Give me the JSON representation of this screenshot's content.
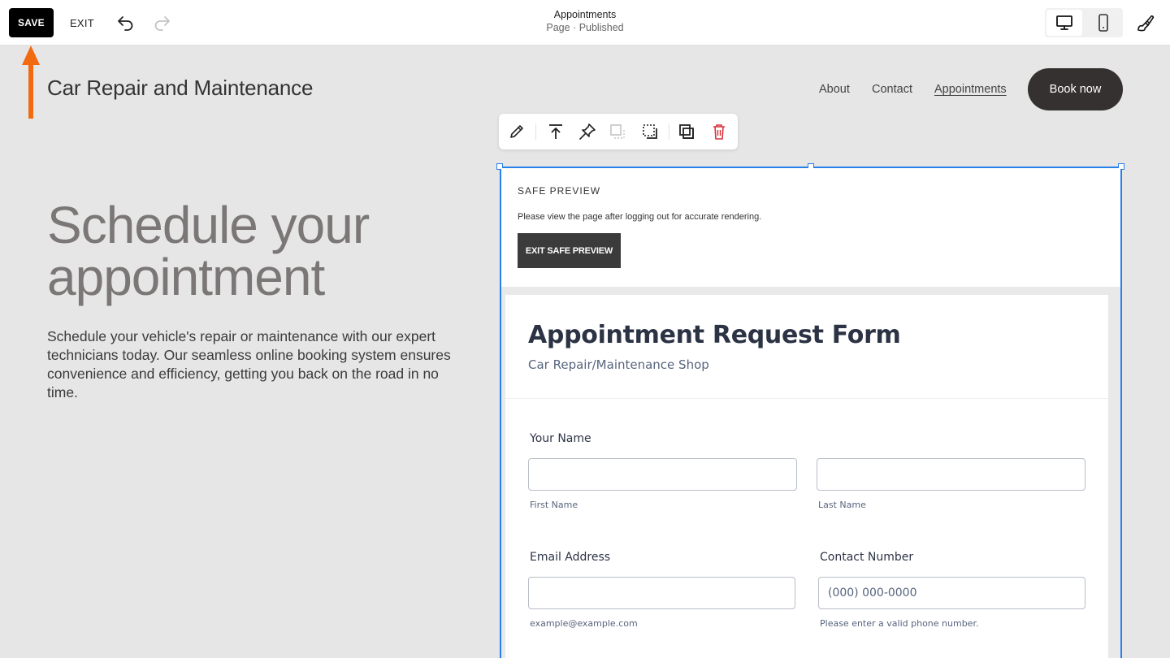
{
  "topbar": {
    "save_label": "SAVE",
    "exit_label": "EXIT",
    "page_title": "Appointments",
    "page_status": "Page · Published",
    "icons": [
      "undo-icon",
      "redo-icon",
      "desktop-icon",
      "mobile-icon",
      "paintbrush-icon"
    ]
  },
  "site": {
    "title": "Car Repair and Maintenance",
    "nav": [
      {
        "label": "About"
      },
      {
        "label": "Contact"
      },
      {
        "label": "Appointments",
        "active": true
      }
    ],
    "book_label": "Book now"
  },
  "hero": {
    "heading": "Schedule your appointment",
    "text": "Schedule your vehicle's repair or maintenance with our expert technicians today. Our seamless online booking system ensures convenience and efficiency, getting you back on the road in no time."
  },
  "block_toolbar": {
    "icons": [
      "pencil-icon",
      "move-to-top-icon",
      "pin-icon",
      "disabled-arrange-icon",
      "select-area-icon",
      "duplicate-icon",
      "trash-icon"
    ]
  },
  "safe_preview": {
    "title": "SAFE PREVIEW",
    "text": "Please view the page after logging out for accurate rendering.",
    "button": "EXIT SAFE PREVIEW"
  },
  "form": {
    "title": "Appointment Request Form",
    "subtitle": "Car Repair/Maintenance Shop",
    "name_label": "Your Name",
    "first_name_sublabel": "First Name",
    "last_name_sublabel": "Last Name",
    "email_label": "Email Address",
    "email_sublabel": "example@example.com",
    "phone_label": "Contact Number",
    "phone_placeholder": "(000) 000-0000",
    "phone_sublabel": "Please enter a valid phone number."
  },
  "colors": {
    "accent_selection": "#2680eb",
    "annotation_arrow": "#f26a10",
    "delete_red": "#d8323c",
    "button_dark": "#353131",
    "page_bg": "#e7e6e6"
  }
}
